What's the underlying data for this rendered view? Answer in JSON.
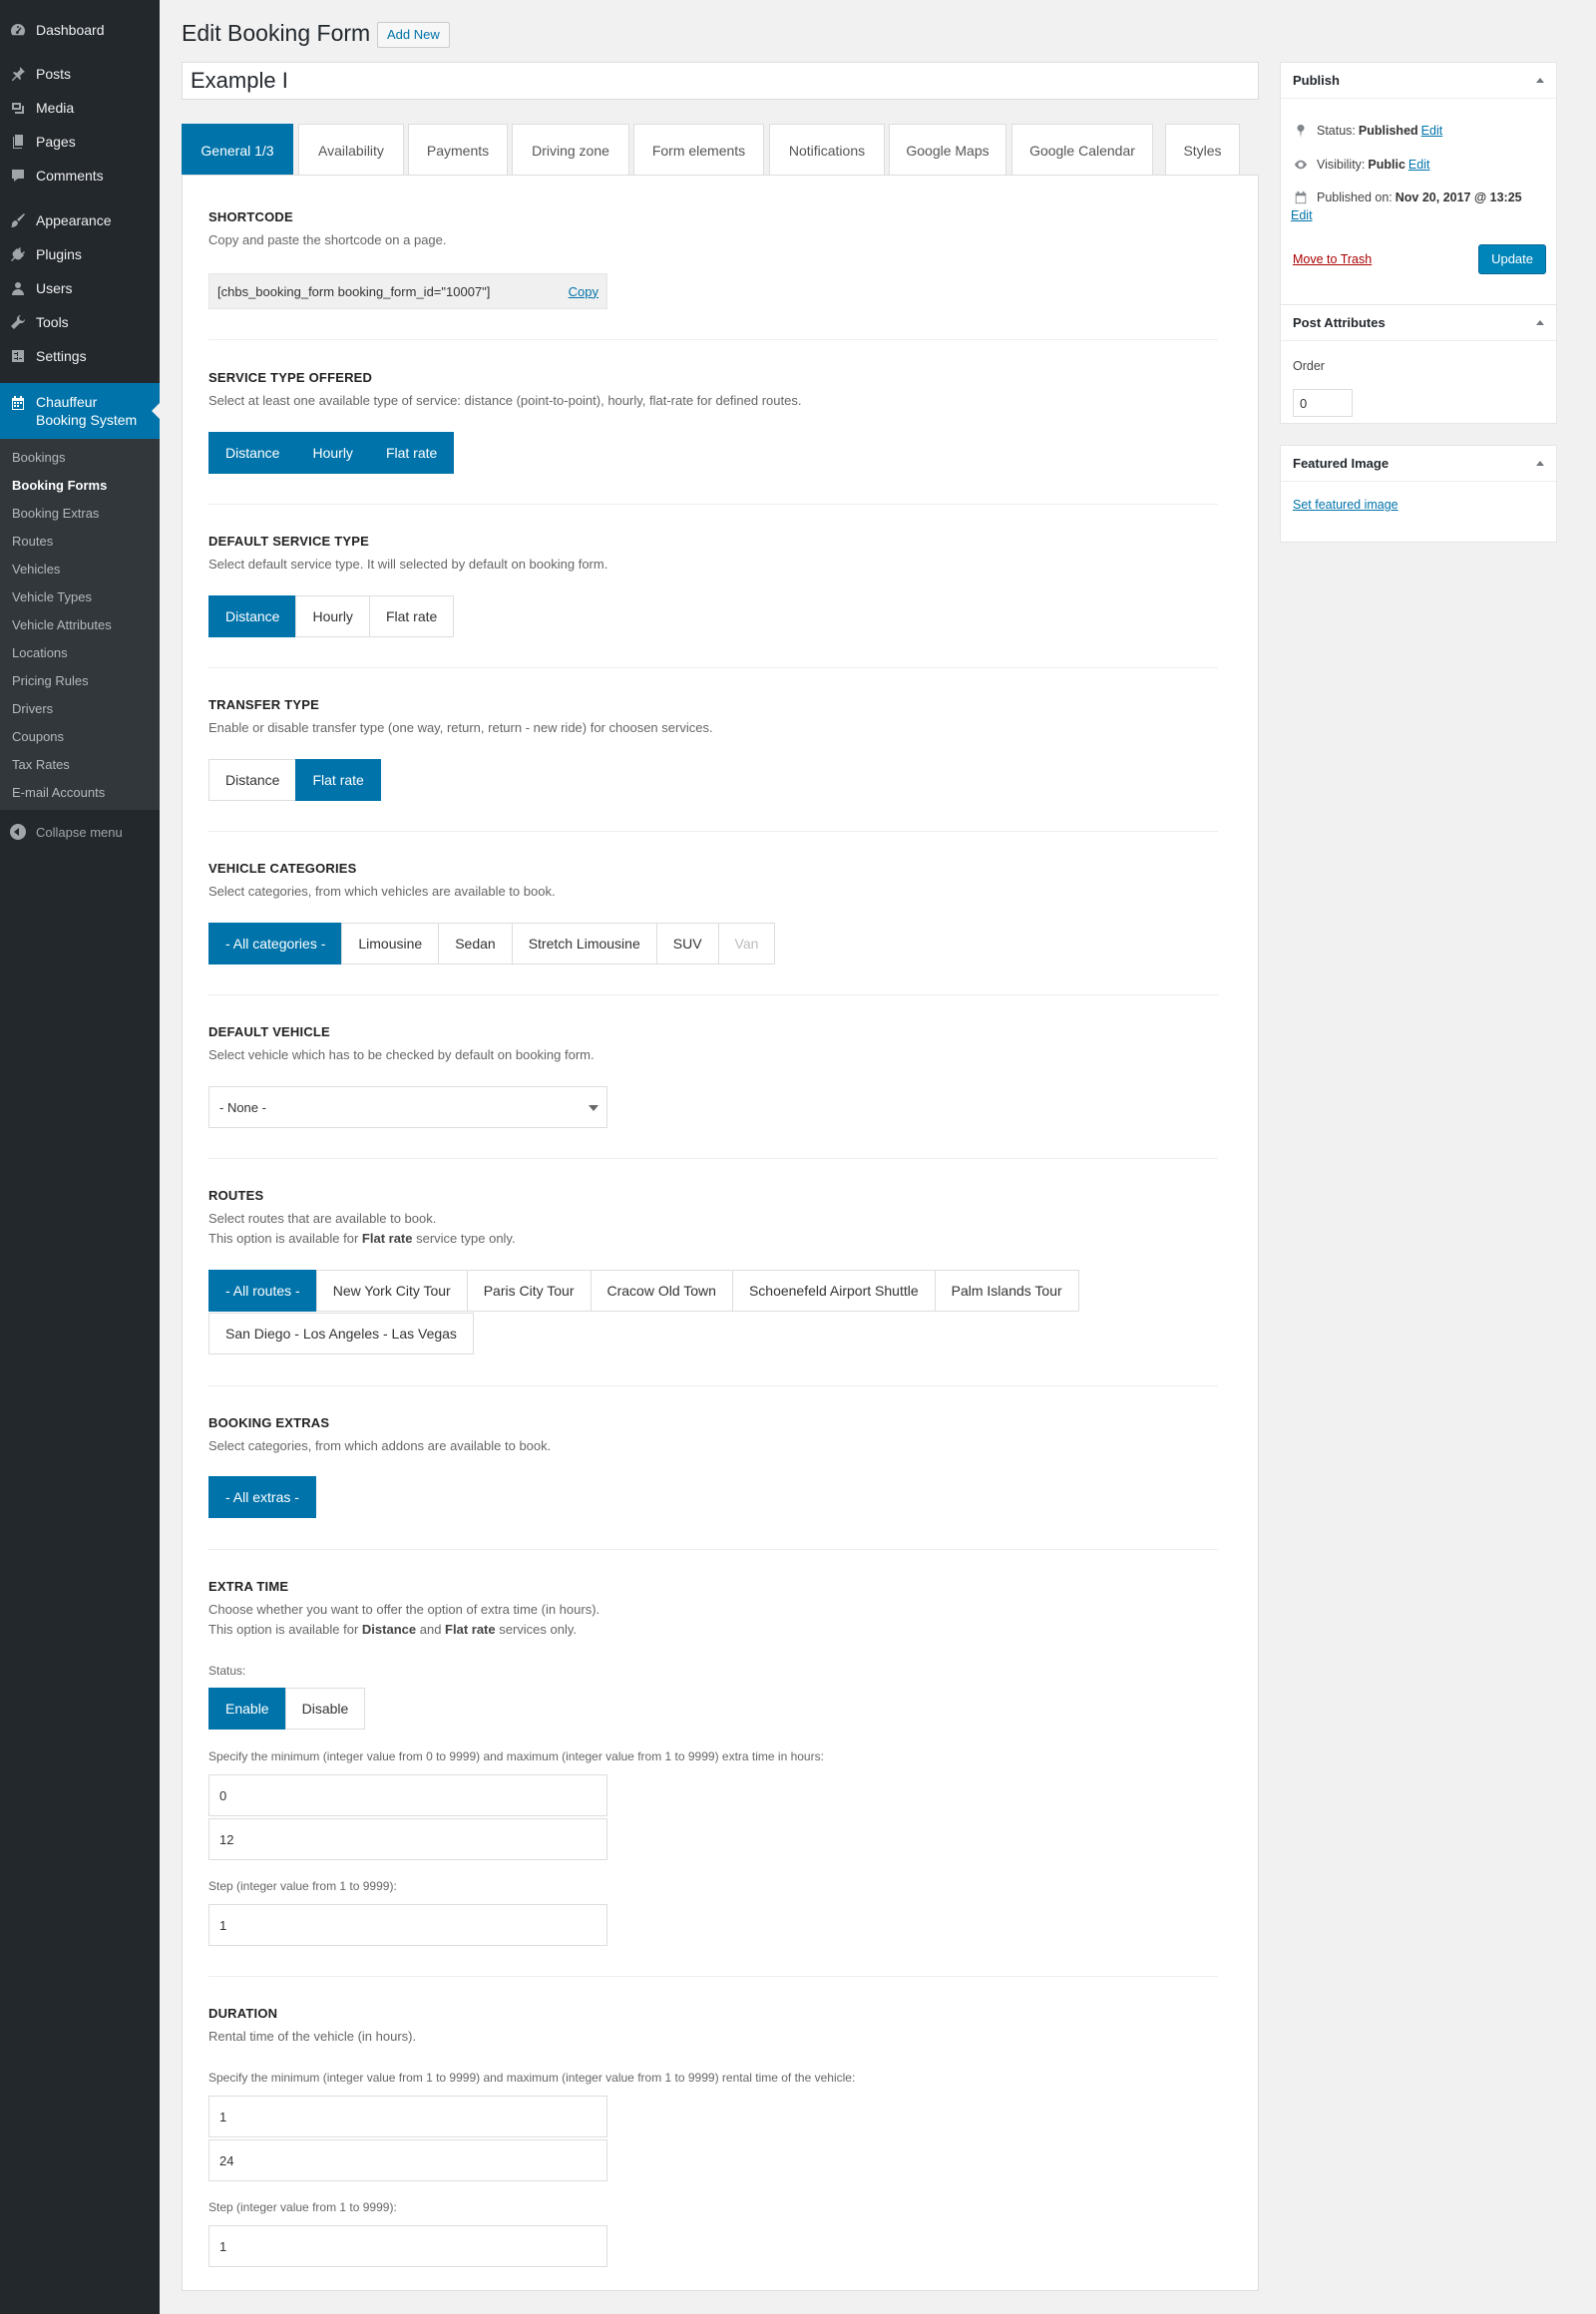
{
  "menu": {
    "top": [
      {
        "label": "Dashboard",
        "icon": "dashboard-icon"
      },
      {
        "label": "Posts",
        "icon": "pin-icon"
      },
      {
        "label": "Media",
        "icon": "media-icon"
      },
      {
        "label": "Pages",
        "icon": "pages-icon"
      },
      {
        "label": "Comments",
        "icon": "comment-icon"
      },
      {
        "label": "Appearance",
        "icon": "brush-icon"
      },
      {
        "label": "Plugins",
        "icon": "plug-icon"
      },
      {
        "label": "Users",
        "icon": "user-icon"
      },
      {
        "label": "Tools",
        "icon": "wrench-icon"
      },
      {
        "label": "Settings",
        "icon": "settings-icon"
      }
    ],
    "current": {
      "line1": "Chauffeur",
      "line2": "Booking System",
      "icon": "calendar-icon"
    },
    "sub": [
      "Bookings",
      "Booking Forms",
      "Booking Extras",
      "Routes",
      "Vehicles",
      "Vehicle Types",
      "Vehicle Attributes",
      "Locations",
      "Pricing Rules",
      "Drivers",
      "Coupons",
      "Tax Rates",
      "E-mail Accounts"
    ],
    "collapse": "Collapse menu"
  },
  "header": {
    "title": "Edit Booking Form",
    "add_new": "Add New",
    "post_title": "Example I"
  },
  "tabs": [
    "General 1/3",
    "Availability",
    "Payments",
    "Driving zone",
    "Form elements",
    "Notifications",
    "Google Maps",
    "Google Calendar",
    "Styles"
  ],
  "sections": {
    "shortcode": {
      "title": "SHORTCODE",
      "desc": "Copy and paste the shortcode on a page.",
      "code": "[chbs_booking_form booking_form_id=\"10007\"]",
      "copy": "Copy"
    },
    "service_type": {
      "title": "SERVICE TYPE OFFERED",
      "desc": "Select at least one available type of service: distance (point-to-point), hourly, flat-rate for defined routes.",
      "options": [
        "Distance",
        "Hourly",
        "Flat rate"
      ]
    },
    "default_service": {
      "title": "DEFAULT SERVICE TYPE",
      "desc": "Select default service type. It will selected by default on booking form.",
      "options": [
        "Distance",
        "Hourly",
        "Flat rate"
      ]
    },
    "transfer": {
      "title": "TRANSFER TYPE",
      "desc": "Enable or disable transfer type (one way, return, return - new ride) for choosen services.",
      "options": [
        "Distance",
        "Flat rate"
      ]
    },
    "vehicle_categories": {
      "title": "VEHICLE CATEGORIES",
      "desc": "Select categories, from which vehicles are available to book.",
      "options": [
        "- All categories -",
        "Limousine",
        "Sedan",
        "Stretch Limousine",
        "SUV",
        "Van"
      ]
    },
    "default_vehicle": {
      "title": "DEFAULT VEHICLE",
      "desc": "Select vehicle which has to be checked by default on booking form.",
      "value": "- None -"
    },
    "routes": {
      "title": "ROUTES",
      "desc1": "Select routes that are available to book.",
      "desc2_pre": "This option is available for ",
      "desc2_bold": "Flat rate",
      "desc2_post": " service type only.",
      "options": [
        "- All routes -",
        "New York City Tour",
        "Paris City Tour",
        "Cracow Old Town",
        "Schoenefeld Airport Shuttle",
        "Palm Islands Tour"
      ],
      "options2": [
        "San Diego - Los Angeles - Las Vegas"
      ]
    },
    "extras": {
      "title": "BOOKING EXTRAS",
      "desc": "Select categories, from which addons are available to book.",
      "options": [
        "- All extras -"
      ]
    },
    "extra_time": {
      "title": "EXTRA TIME",
      "desc1": "Choose whether you want to offer the option of extra time (in hours).",
      "desc2_pre": "This option is available for ",
      "desc2_b1": "Distance",
      "desc2_mid": " and ",
      "desc2_b2": "Flat rate",
      "desc2_post": " services only.",
      "status_label": "Status:",
      "options": [
        "Enable",
        "Disable"
      ],
      "minmax_label": "Specify the minimum (integer value from 0 to 9999) and maximum (integer value from 1 to 9999) extra time in hours:",
      "min": "0",
      "max": "12",
      "step_label": "Step (integer value from 1 to 9999):",
      "step": "1"
    },
    "duration": {
      "title": "DURATION",
      "desc": "Rental time of the vehicle (in hours).",
      "minmax_label": "Specify the minimum (integer value from 1 to 9999) and maximum (integer value from 1 to 9999) rental time of the vehicle:",
      "min": "1",
      "max": "24",
      "step_label": "Step (integer value from 1 to 9999):",
      "step": "1"
    }
  },
  "publish": {
    "title": "Publish",
    "status_label": "Status:",
    "status": "Published",
    "visibility_label": "Visibility:",
    "visibility": "Public",
    "published_label": "Published on:",
    "published": "Nov 20, 2017 @ 13:25",
    "edit": "Edit",
    "trash": "Move to Trash",
    "update": "Update"
  },
  "attributes": {
    "title": "Post Attributes",
    "order_label": "Order",
    "order": "0"
  },
  "featured": {
    "title": "Featured Image",
    "link": "Set featured image"
  }
}
